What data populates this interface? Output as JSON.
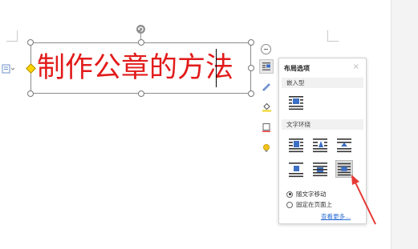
{
  "document": {
    "textbox_text": "制作公章的方法"
  },
  "layout_panel": {
    "title": "布局选项",
    "close_symbol": "×",
    "inline_section": "嵌入型",
    "wrap_section": "文字环绕",
    "options": [
      {
        "label": "随文字移动",
        "checked": true
      },
      {
        "label": "固定在页面上",
        "checked": false
      }
    ],
    "more_link": "查看更多..."
  },
  "colors": {
    "title_text": "#e21b1b",
    "accent_blue": "#2f6fd6",
    "annotation_arrow": "#e53935",
    "handle_yellow": "#ffd400"
  },
  "icons": {
    "side_toolbar": [
      "layout-options-icon",
      "pen-icon",
      "fill-color-icon",
      "border-icon",
      "lightbulb-icon"
    ],
    "wrap_options": [
      "square-wrap-icon",
      "tight-wrap-icon",
      "through-wrap-icon",
      "top-bottom-wrap-icon",
      "behind-text-icon",
      "in-front-of-text-icon"
    ]
  }
}
